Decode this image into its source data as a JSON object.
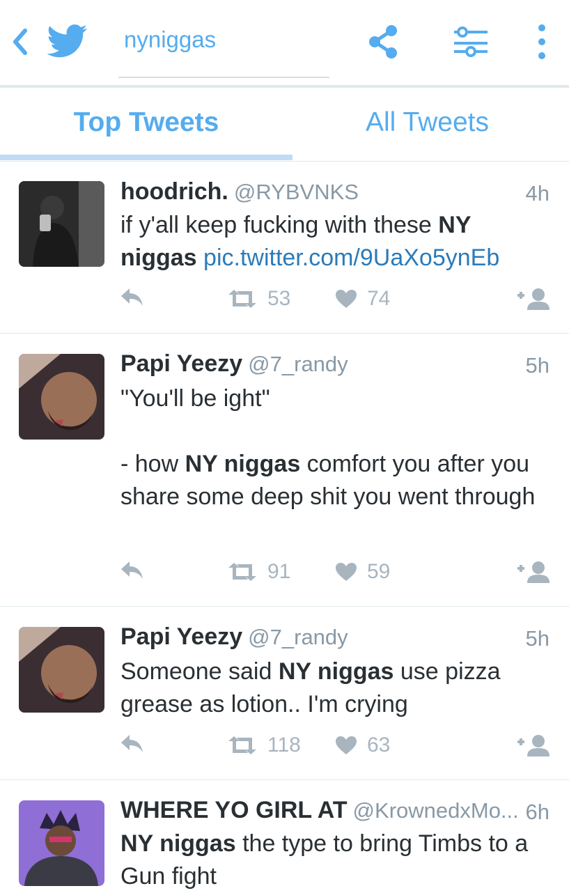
{
  "header": {
    "search_query": "nyniggas",
    "colors": {
      "accent": "#55acee",
      "muted": "#a8b5bf",
      "text": "#292f33"
    }
  },
  "tabs": [
    {
      "label": "Top Tweets"
    },
    {
      "label": "All Tweets"
    }
  ],
  "tweets": [
    {
      "name": "hoodrich.",
      "handle": "@RYBVNKS",
      "time": "4h",
      "text_1": "if y'all keep fucking with these ",
      "bold_1": "NY niggas",
      "link": "pic.twitter.com/9UaXo5ynEb",
      "retweets": "53",
      "likes": "74"
    },
    {
      "name": "Papi Yeezy",
      "handle": "@7_randy",
      "time": "5h",
      "line_1": "\"You'll be ight\"",
      "text_pre": "- how ",
      "bold_1": "NY niggas",
      "text_post": " comfort you after you share some deep shit you went through",
      "retweets": "91",
      "likes": "59"
    },
    {
      "name": "Papi Yeezy",
      "handle": "@7_randy",
      "time": "5h",
      "text_pre": "Someone said ",
      "bold_1": "NY niggas",
      "text_post": " use pizza grease as lotion.. I'm crying",
      "retweets": "118",
      "likes": "63"
    },
    {
      "name": "WHERE YO GIRL AT",
      "handle": "@KrownedxMo...",
      "time": "6h",
      "bold_1": "NY niggas",
      "text_post": " the type to bring Timbs to a Gun fight"
    }
  ]
}
